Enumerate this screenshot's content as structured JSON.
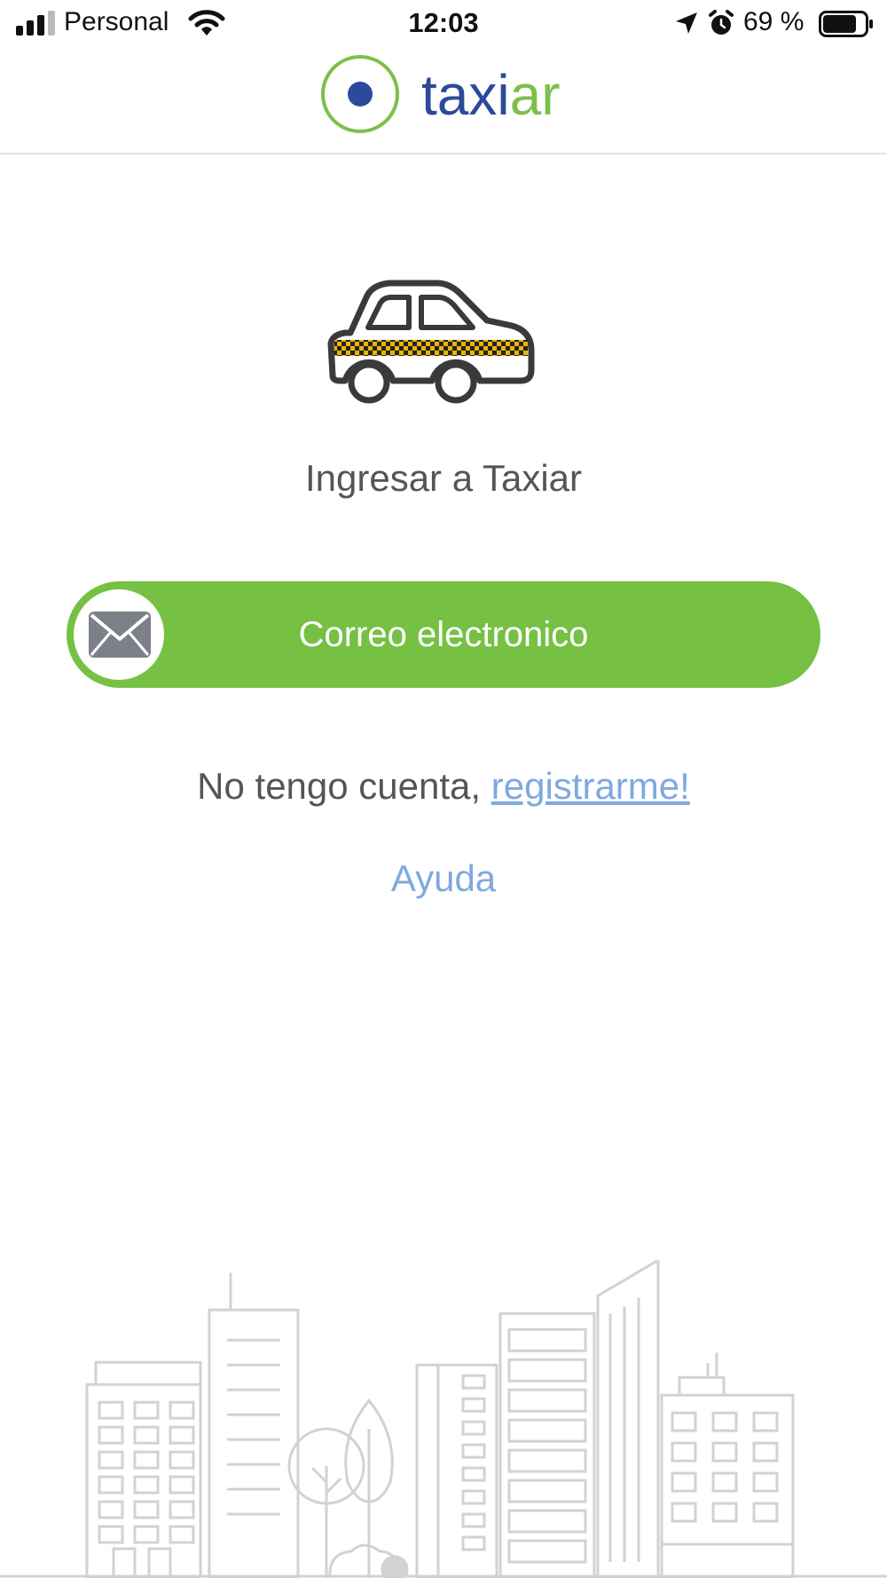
{
  "status_bar": {
    "carrier": "Personal",
    "time": "12:03",
    "battery_percent": "69 %",
    "icons": [
      "signal-icon",
      "wifi-icon",
      "location-arrow-icon",
      "alarm-icon",
      "battery-icon"
    ]
  },
  "header": {
    "logo": {
      "part1": "taxi",
      "part2": "ar"
    }
  },
  "main": {
    "illustration": "taxi-car-icon",
    "heading": "Ingresar a Taxiar",
    "email_button": {
      "label": "Correo electronico",
      "icon": "envelope-icon"
    },
    "register": {
      "prefix": "No tengo cuenta, ",
      "link": "registrarme!"
    },
    "help_link": "Ayuda",
    "footer_illustration": "city-skyline"
  },
  "colors": {
    "brand_green": "#76c043",
    "brand_blue": "#2c4a9b",
    "link_blue": "#7fa9df",
    "text_gray": "#555555",
    "taxi_stripe": "#f0b400"
  }
}
